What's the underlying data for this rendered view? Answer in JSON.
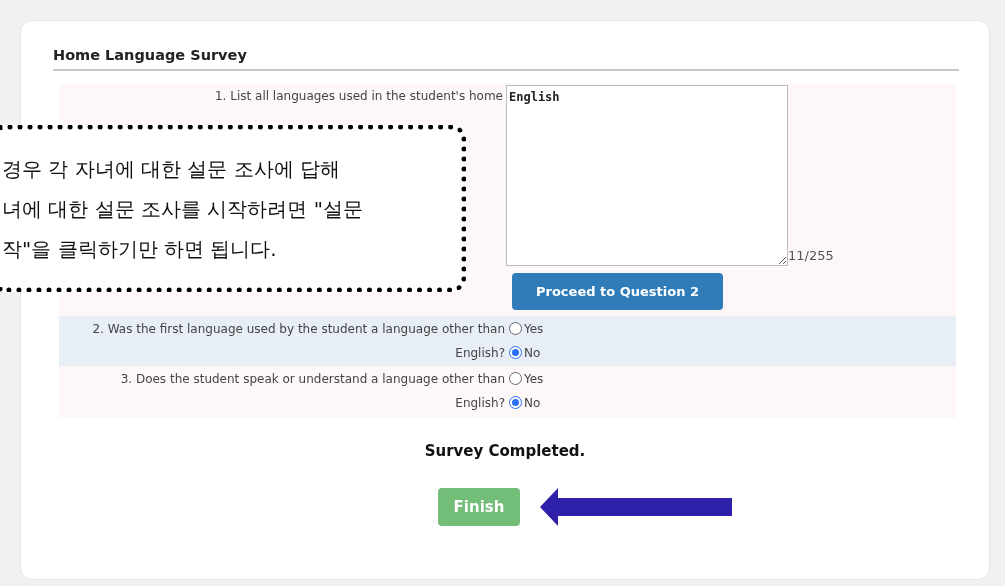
{
  "section": {
    "title": "Home Language Survey"
  },
  "questions": [
    {
      "kind": "text",
      "label": "1. List all languages used in the student's home",
      "value": "English",
      "counter": "11/255",
      "button": "Proceed to Question 2"
    },
    {
      "kind": "radio",
      "label": "2. Was the first language used by the student a language other than English?",
      "highlighted": true,
      "options": [
        {
          "label": "Yes",
          "selected": false
        },
        {
          "label": "No",
          "selected": true
        }
      ]
    },
    {
      "kind": "radio",
      "label": "3. Does the student speak or understand a language other than English?",
      "highlighted": false,
      "options": [
        {
          "label": "Yes",
          "selected": false
        },
        {
          "label": "No",
          "selected": true
        }
      ]
    }
  ],
  "status": "Survey Completed.",
  "finish_button": "Finish",
  "callout": {
    "lines": [
      "경우 각 자녀에 대한 설문 조사에 답해",
      "녀에 대한 설문 조사를 시작하려면 \"설문",
      "작\"을 클릭하기만 하면 됩니다."
    ]
  }
}
